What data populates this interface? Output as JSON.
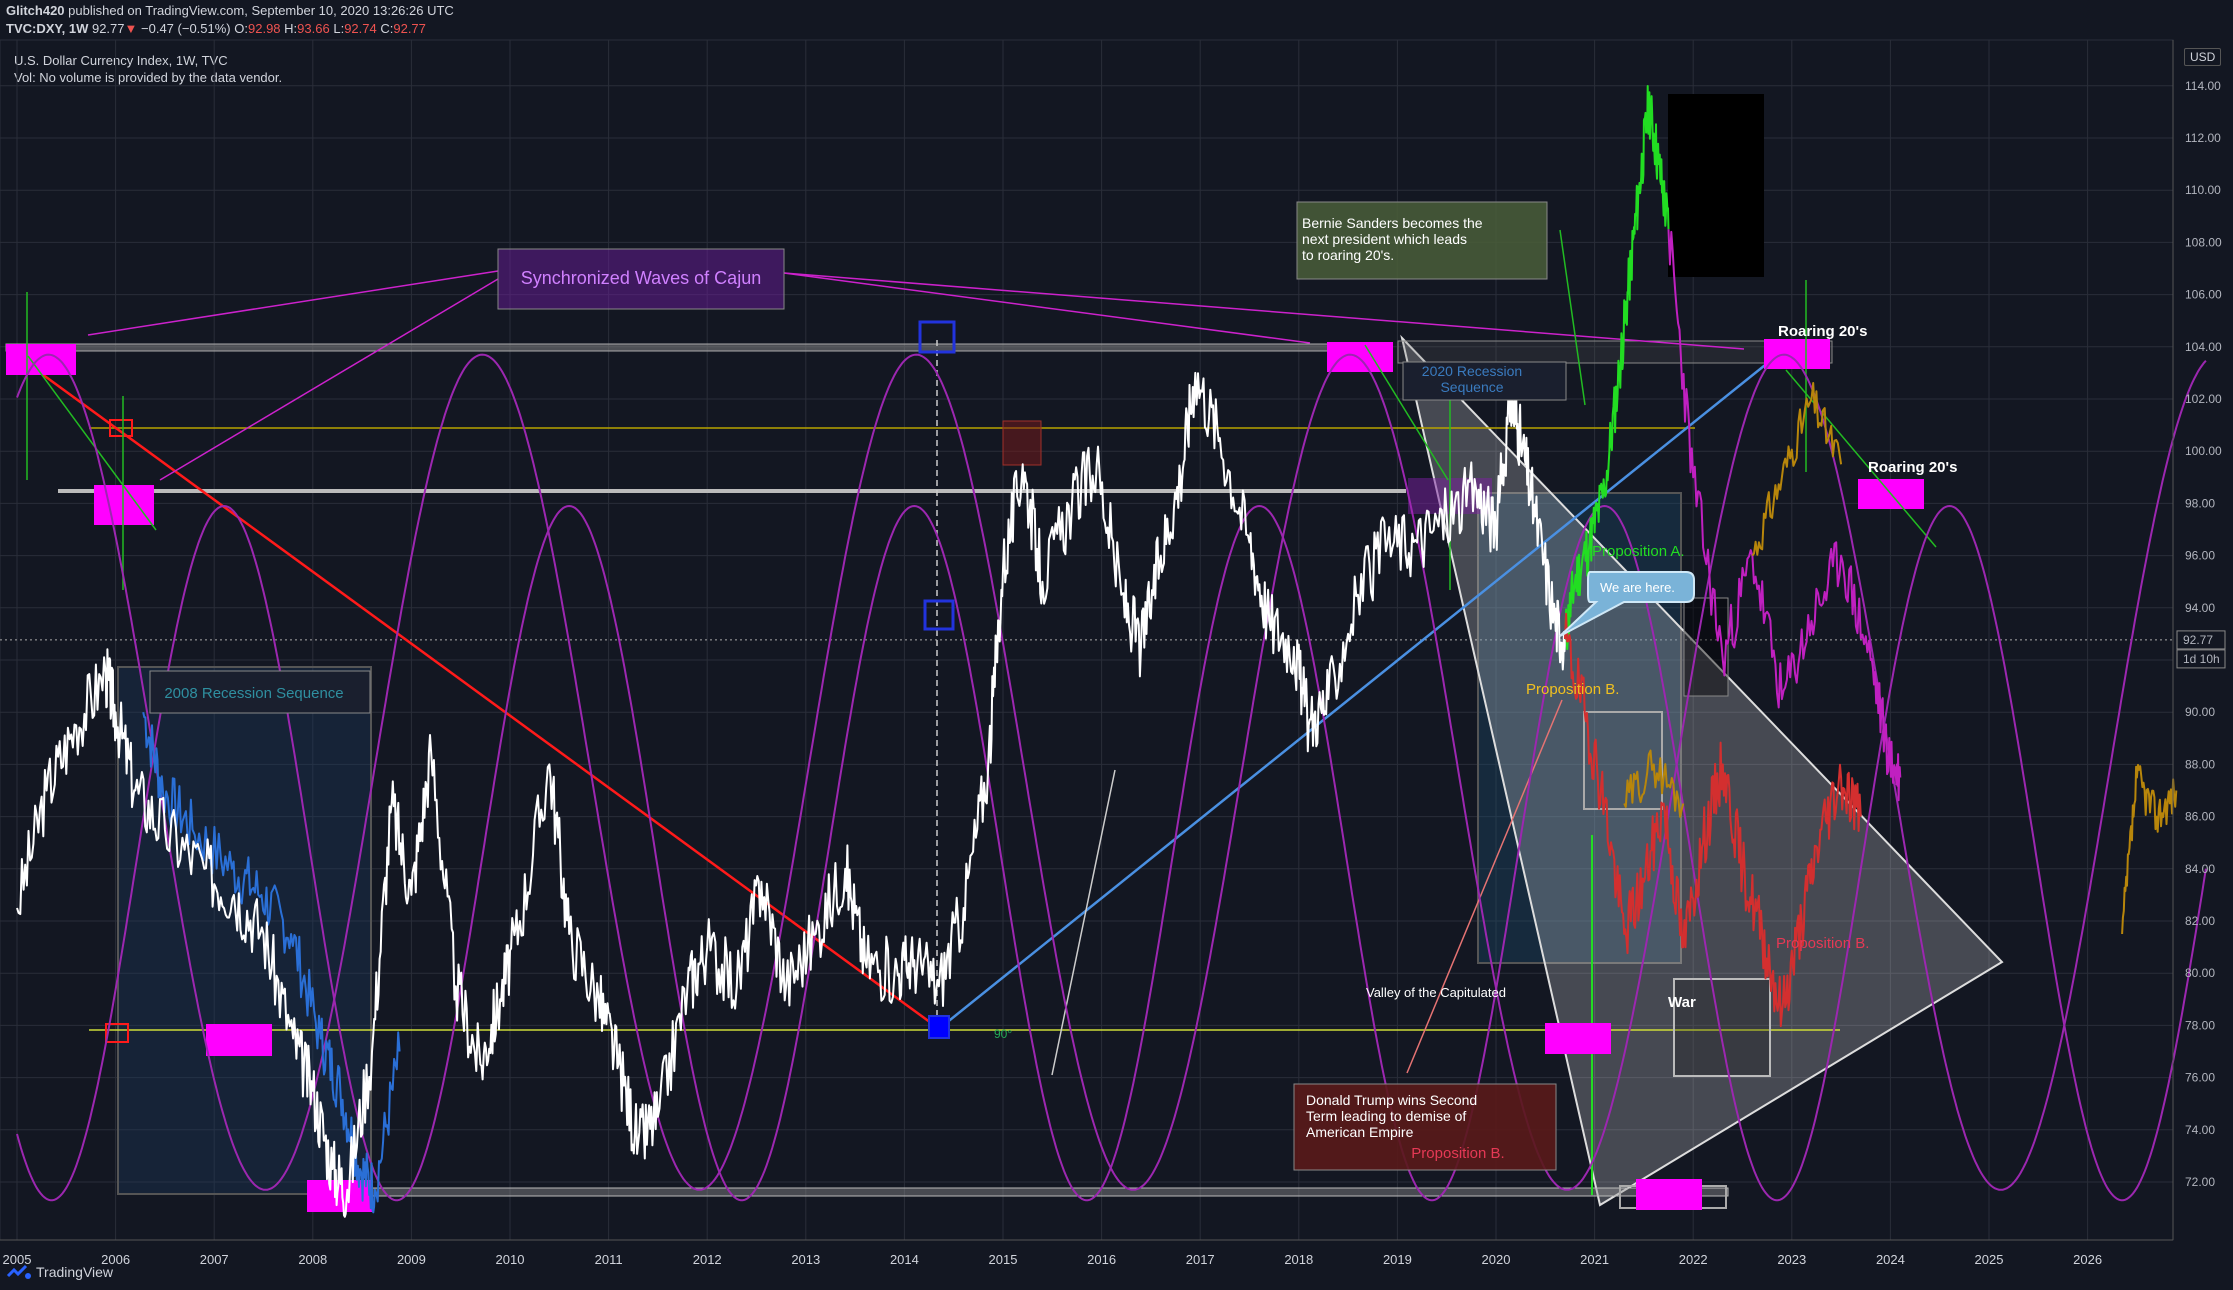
{
  "header": {
    "publisher": "Glitch420",
    "published_text": " published on TradingView.com, September 10, 2020 13:26:26 UTC",
    "symbol": "TVC:DXY, 1W",
    "last": "92.77",
    "change": "−0.47 (−0.51%)",
    "open_label": "O:",
    "open": "92.98",
    "high_label": "H:",
    "high": "93.66",
    "low_label": "L:",
    "low": "92.74",
    "close_label": "C:",
    "close": "92.77"
  },
  "legend": {
    "title": "U.S. Dollar Currency Index, 1W, TVC",
    "volume_note": "Vol: No volume is provided by the data vendor."
  },
  "price_scale": {
    "currency": "USD",
    "last_price_label": "92.77",
    "countdown_label": "1d 10h"
  },
  "footer": {
    "brand": "TradingView"
  },
  "annotations": {
    "waves_title": "Synchronized Waves of Cajun",
    "bernie": "Bernie Sanders becomes the next president which leads to roaring 20's.",
    "recession_2020": "2020 Recession Sequence",
    "recession_2008": "2008 Recession Sequence",
    "roaring_1": "Roaring 20's",
    "roaring_2": "Roaring 20's",
    "prop_a": "Proposition A.",
    "we_are_here": "We are here.",
    "prop_b_yellow": "Proposition B.",
    "prop_b_red": "Proposition B.",
    "valley": "Valley of the Capitulated",
    "war": "War",
    "trump": "Donald Trump wins Second Term leading to demise of American Empire",
    "prop_b_trump": "Proposition B.",
    "angle": "90°"
  },
  "colors": {
    "background": "#131722",
    "price": "#ffffff",
    "wave": "#9c27b0",
    "magenta": "#ff00ff",
    "trend_red": "#ff1a1a",
    "trend_blue": "#4a90e2",
    "level_yellow": "#b7a300",
    "green_path": "#22dd22",
    "red_path": "#d32f2f",
    "pink_path": "#c020c0",
    "orange_path": "#b8860b"
  },
  "chart_data": {
    "type": "line",
    "title": "U.S. Dollar Currency Index, 1W, TVC",
    "x_ticks": [
      "2005",
      "2006",
      "2007",
      "2008",
      "2009",
      "2010",
      "2011",
      "2012",
      "2013",
      "2014",
      "2015",
      "2016",
      "2017",
      "2018",
      "2019",
      "2020",
      "2021",
      "2022",
      "2023",
      "2024",
      "2025",
      "2026"
    ],
    "y_ticks": [
      "72.00",
      "74.00",
      "76.00",
      "78.00",
      "80.00",
      "82.00",
      "84.00",
      "86.00",
      "88.00",
      "90.00",
      "92.00",
      "94.00",
      "96.00",
      "98.00",
      "100.00",
      "102.00",
      "104.00",
      "106.00",
      "108.00",
      "110.00",
      "112.00",
      "114.00"
    ],
    "xlim": [
      2005.0,
      2027.2
    ],
    "ylim": [
      70.8,
      115.0
    ],
    "log_scale": false,
    "grid": true,
    "last_value": 92.77,
    "series": [
      {
        "name": "DXY",
        "x": [
          2005.0,
          2005.3,
          2005.6,
          2005.9,
          2006.0,
          2006.2,
          2006.5,
          2006.9,
          2007.2,
          2007.5,
          2007.8,
          2008.0,
          2008.2,
          2008.35,
          2008.6,
          2008.8,
          2009.0,
          2009.2,
          2009.45,
          2009.7,
          2009.9,
          2010.1,
          2010.4,
          2010.6,
          2010.9,
          2011.1,
          2011.3,
          2011.5,
          2011.8,
          2012.0,
          2012.3,
          2012.55,
          2012.8,
          2013.1,
          2013.4,
          2013.6,
          2013.9,
          2014.1,
          2014.35,
          2014.6,
          2014.85,
          2015.0,
          2015.2,
          2015.4,
          2015.7,
          2015.95,
          2016.2,
          2016.4,
          2016.6,
          2016.8,
          2016.95,
          2017.2,
          2017.5,
          2017.7,
          2017.95,
          2018.1,
          2018.3,
          2018.6,
          2018.9,
          2019.2,
          2019.5,
          2019.8,
          2020.0,
          2020.15,
          2020.25,
          2020.4,
          2020.6,
          2020.7
        ],
        "y": [
          82.5,
          87.0,
          89.5,
          91.5,
          90.0,
          87.0,
          85.5,
          84.0,
          83.0,
          81.5,
          77.5,
          75.5,
          72.5,
          71.7,
          77.0,
          86.5,
          83.0,
          88.5,
          79.5,
          76.5,
          79.0,
          82.0,
          88.0,
          81.5,
          79.0,
          76.5,
          73.5,
          74.5,
          79.5,
          81.0,
          79.5,
          83.5,
          79.5,
          81.5,
          84.0,
          80.5,
          80.0,
          80.5,
          79.5,
          82.5,
          88.0,
          95.5,
          99.5,
          95.0,
          98.0,
          99.5,
          94.5,
          92.5,
          96.0,
          99.0,
          103.0,
          100.5,
          96.5,
          93.5,
          92.5,
          89.5,
          90.5,
          94.5,
          96.5,
          96.5,
          97.5,
          98.5,
          97.0,
          102.0,
          100.5,
          97.5,
          93.5,
          92.77
        ]
      },
      {
        "name": "Proposition A",
        "x": [
          2020.7,
          2020.8,
          2020.95,
          2021.1,
          2021.25,
          2021.35,
          2021.45,
          2021.55,
          2021.65,
          2021.75
        ],
        "y": [
          92.8,
          95.0,
          96.5,
          98.5,
          103.0,
          106.5,
          110.0,
          113.3,
          111.0,
          108.5
        ]
      },
      {
        "name": "Proposition B",
        "x": [
          2020.7,
          2020.9,
          2021.1,
          2021.3,
          2021.5,
          2021.7,
          2021.9,
          2022.1,
          2022.3,
          2022.5,
          2022.7,
          2022.9,
          2023.1,
          2023.3,
          2023.5,
          2023.7
        ],
        "y": [
          92.8,
          90.0,
          86.5,
          81.5,
          83.5,
          86.5,
          81.0,
          85.0,
          88.0,
          84.0,
          81.5,
          78.5,
          82.0,
          85.5,
          87.5,
          86.0
        ]
      }
    ]
  }
}
